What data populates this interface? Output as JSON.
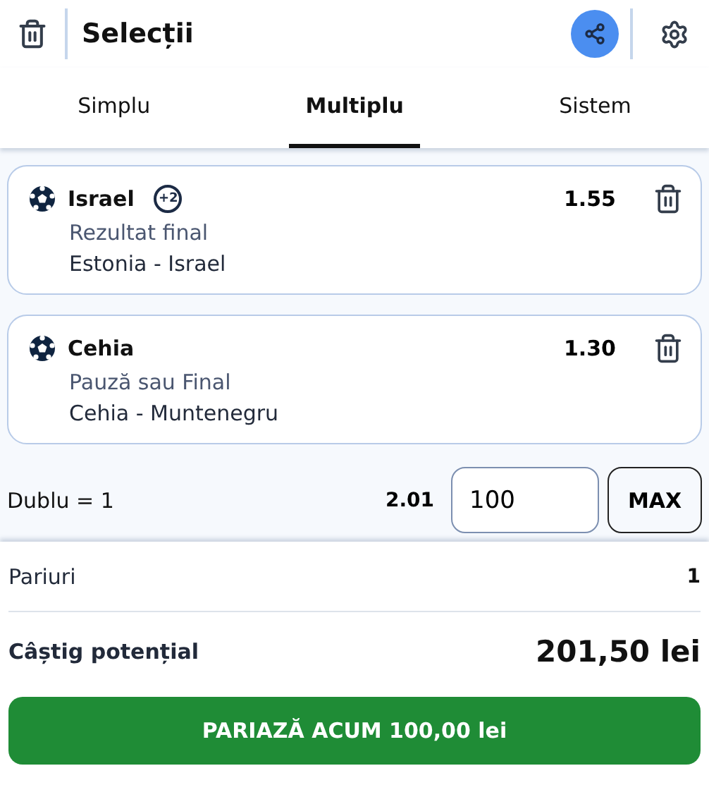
{
  "header": {
    "title": "Selecții"
  },
  "tabs": [
    {
      "label": "Simplu",
      "selected": false
    },
    {
      "label": "Multiplu",
      "selected": true
    },
    {
      "label": "Sistem",
      "selected": false
    }
  ],
  "selections": [
    {
      "team": "Israel",
      "extra": "+2",
      "odds": "1.55",
      "market": "Rezultat final",
      "event": "Estonia - Israel"
    },
    {
      "team": "Cehia",
      "odds": "1.30",
      "market": "Pauză sau Final",
      "event": "Cehia - Muntenegru"
    }
  ],
  "stake_row": {
    "label": "Dublu = 1",
    "odds": "2.01",
    "stake": "100",
    "max_button": "MAX"
  },
  "summary": [
    {
      "label": "Pariuri",
      "value": "1",
      "kind": "count"
    },
    {
      "label": "Câștig potențial",
      "value": "201,50 lei",
      "kind": "win"
    }
  ],
  "place_button": "PARIAZĂ ACUM 100,00 lei"
}
